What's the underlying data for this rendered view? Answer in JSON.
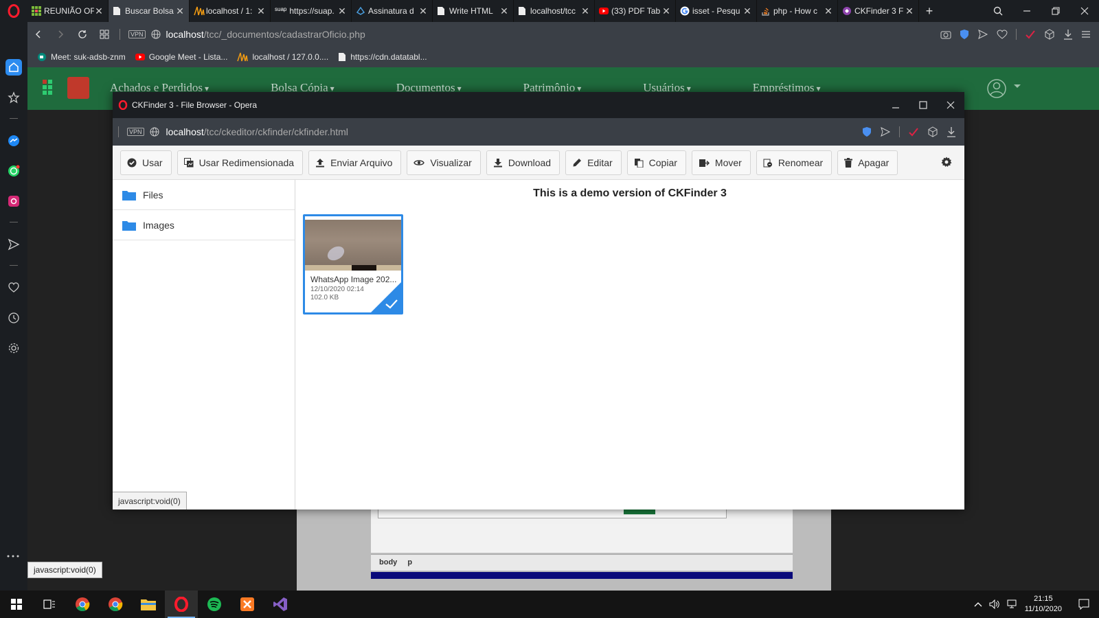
{
  "browser": {
    "tabs": [
      {
        "title": "REUNIÃO OF",
        "icon": "grid-icon",
        "active": false
      },
      {
        "title": "Buscar Bolsa",
        "icon": "page-icon",
        "active": true
      },
      {
        "title": "localhost / 1:",
        "icon": "phpmyadmin-icon",
        "active": false
      },
      {
        "title": "https://suap.",
        "icon": "suap-icon",
        "active": false
      },
      {
        "title": "Assinatura d",
        "icon": "signature-icon",
        "active": false
      },
      {
        "title": "Write HTML",
        "icon": "page-icon",
        "active": false
      },
      {
        "title": "localhost/tcc",
        "icon": "page-icon",
        "active": false
      },
      {
        "title": "(33) PDF Tab",
        "icon": "youtube-icon",
        "active": false
      },
      {
        "title": "isset - Pesqu",
        "icon": "google-icon",
        "active": false
      },
      {
        "title": "php - How c",
        "icon": "stackoverflow-icon",
        "active": false
      },
      {
        "title": "CKFinder 3 F",
        "icon": "ckfinder-icon",
        "active": false
      }
    ],
    "suap_label": "suap",
    "url_host": "localhost",
    "url_path": "/tcc/_documentos/cadastrarOficio.php",
    "vpn_label": "VPN",
    "bookmarks": [
      {
        "label": "Meet: suk-adsb-znm",
        "icon": "meet-icon"
      },
      {
        "label": "Google Meet - Lista...",
        "icon": "youtube-icon"
      },
      {
        "label": "localhost / 127.0.0....",
        "icon": "phpmyadmin-icon"
      },
      {
        "label": "https://cdn.datatabl...",
        "icon": "page-icon"
      }
    ]
  },
  "site": {
    "menu": [
      "Achados e Perdidos",
      "Bolsa Cópia",
      "Documentos",
      "Patrimônio",
      "Usuários",
      "Empréstimos"
    ],
    "editor_path": [
      "body",
      "p"
    ]
  },
  "popup": {
    "title": "CKFinder 3 - File Browser - Opera",
    "url_host": "localhost",
    "url_path": "/tcc/ckeditor/ckfinder/ckfinder.html",
    "toolbar": [
      {
        "label": "Usar",
        "icon": "check-circle-icon"
      },
      {
        "label": "Usar Redimensionada",
        "icon": "resize-image-icon"
      },
      {
        "label": "Enviar Arquivo",
        "icon": "upload-icon"
      },
      {
        "label": "Visualizar",
        "icon": "eye-icon"
      },
      {
        "label": "Download",
        "icon": "download-icon"
      },
      {
        "label": "Editar",
        "icon": "pencil-icon"
      },
      {
        "label": "Copiar",
        "icon": "copy-icon"
      },
      {
        "label": "Mover",
        "icon": "move-icon"
      },
      {
        "label": "Renomear",
        "icon": "rename-icon"
      },
      {
        "label": "Apagar",
        "icon": "trash-icon"
      }
    ],
    "folders": [
      "Files",
      "Images"
    ],
    "demo_message": "This is a demo version of CKFinder 3",
    "file": {
      "name": "WhatsApp Image 202...",
      "date": "12/10/2020 02:14",
      "size": "102.0 KB",
      "selected": true
    },
    "status_tip": "javascript:void(0)"
  },
  "status_tip": "javascript:void(0)",
  "taskbar": {
    "time": "21:15",
    "date": "11/10/2020"
  },
  "colors": {
    "accent": "#2d8ae6",
    "site_nav": "#1f6b3d",
    "opera_red": "#ff1b2d"
  }
}
